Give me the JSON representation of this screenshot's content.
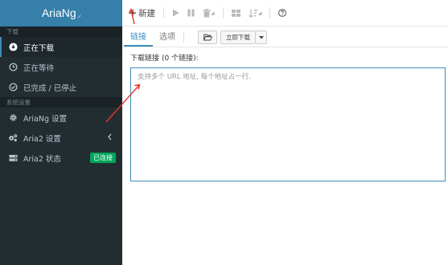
{
  "brand": {
    "title": "AriaNg"
  },
  "sidebar": {
    "section_download": "下载",
    "download_items": [
      {
        "label": "正在下载",
        "icon": "download-circle-icon"
      },
      {
        "label": "正在等待",
        "icon": "clock-icon"
      },
      {
        "label": "已完成 / 已停止",
        "icon": "check-circle-icon"
      }
    ],
    "section_settings": "系统设置",
    "settings_items": [
      {
        "label": "AriaNg 设置",
        "icon": "gear-icon"
      },
      {
        "label": "Aria2 设置",
        "icon": "gears-icon"
      },
      {
        "label": "Aria2 状态",
        "icon": "server-icon",
        "badge": "已连接"
      }
    ]
  },
  "toolbar": {
    "new_label": "新建",
    "icons": [
      "play-icon",
      "pause-icon",
      "trash-icon",
      "grid-icon",
      "sort-icon",
      "help-icon"
    ]
  },
  "tabs": {
    "links_label": "链接",
    "options_label": "选项",
    "download_now_label": "立即下载"
  },
  "form": {
    "links_label": "下载链接",
    "links_count": "(0 个链接):",
    "placeholder": "支持多个 URL 地址, 每个地址占一行."
  },
  "colors": {
    "sidebar_bg": "#222d32",
    "brand_bg": "#367fa9",
    "accent": "#3c8dbc",
    "badge_green": "#00a65a",
    "arrow_red": "#e8322a"
  }
}
